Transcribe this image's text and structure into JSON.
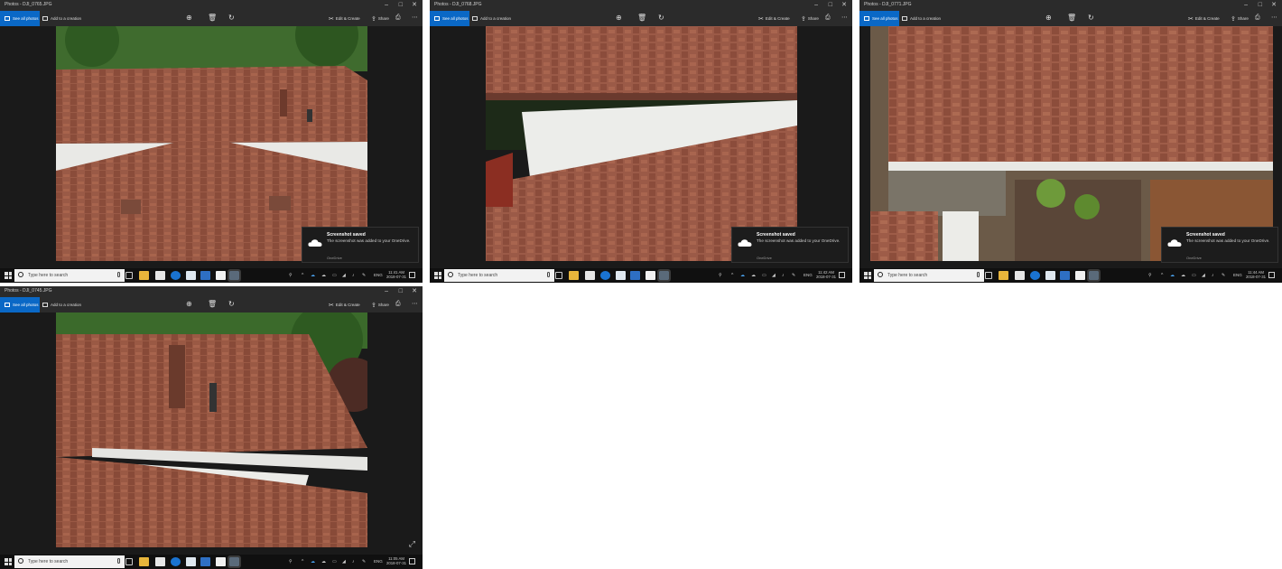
{
  "screens": [
    {
      "title": "Photos - DJI_0765.JPG",
      "clock": {
        "time": "11:41 AM",
        "date": "2018-07-31"
      },
      "toast": {
        "title": "Screenshot saved",
        "body": "The screenshot was added to your OneDrive.",
        "source": "OneDrive"
      }
    },
    {
      "title": "Photos - DJI_0768.JPG",
      "clock": {
        "time": "11:42 AM",
        "date": "2018-07-31"
      },
      "toast": {
        "title": "Screenshot saved",
        "body": "The screenshot was added to your OneDrive.",
        "source": "OneDrive"
      }
    },
    {
      "title": "Photos - DJI_0771.JPG",
      "clock": {
        "time": "11:44 AM",
        "date": "2018-07-31"
      },
      "toast": {
        "title": "Screenshot saved",
        "body": "The screenshot was added to your OneDrive.",
        "source": "OneDrive"
      }
    },
    {
      "title": "Photos - DJI_0745.JPG",
      "clock": {
        "time": "11:05 AM",
        "date": "2018-07-31"
      }
    }
  ],
  "toolbar": {
    "see_all_photos": "See all photos",
    "add_to_creation": "Add to a creation",
    "edit_create": "Edit & Create",
    "share": "Share",
    "icons": [
      "zoom-icon",
      "delete-icon",
      "rotate-icon",
      "print-icon",
      "more-icon"
    ]
  },
  "window_controls": {
    "minimize": "–",
    "maximize": "□",
    "close": "✕"
  },
  "taskbar": {
    "search_placeholder": "Type here to search",
    "language": "ENG",
    "apps": [
      "task-view",
      "file-explorer",
      "store",
      "edge",
      "app",
      "app",
      "mail",
      "photos"
    ]
  },
  "colors": {
    "accent": "#0a68c6",
    "taskbar": "#101010",
    "toolbar": "#2b2b2b",
    "shingle": "#9a5a46"
  }
}
